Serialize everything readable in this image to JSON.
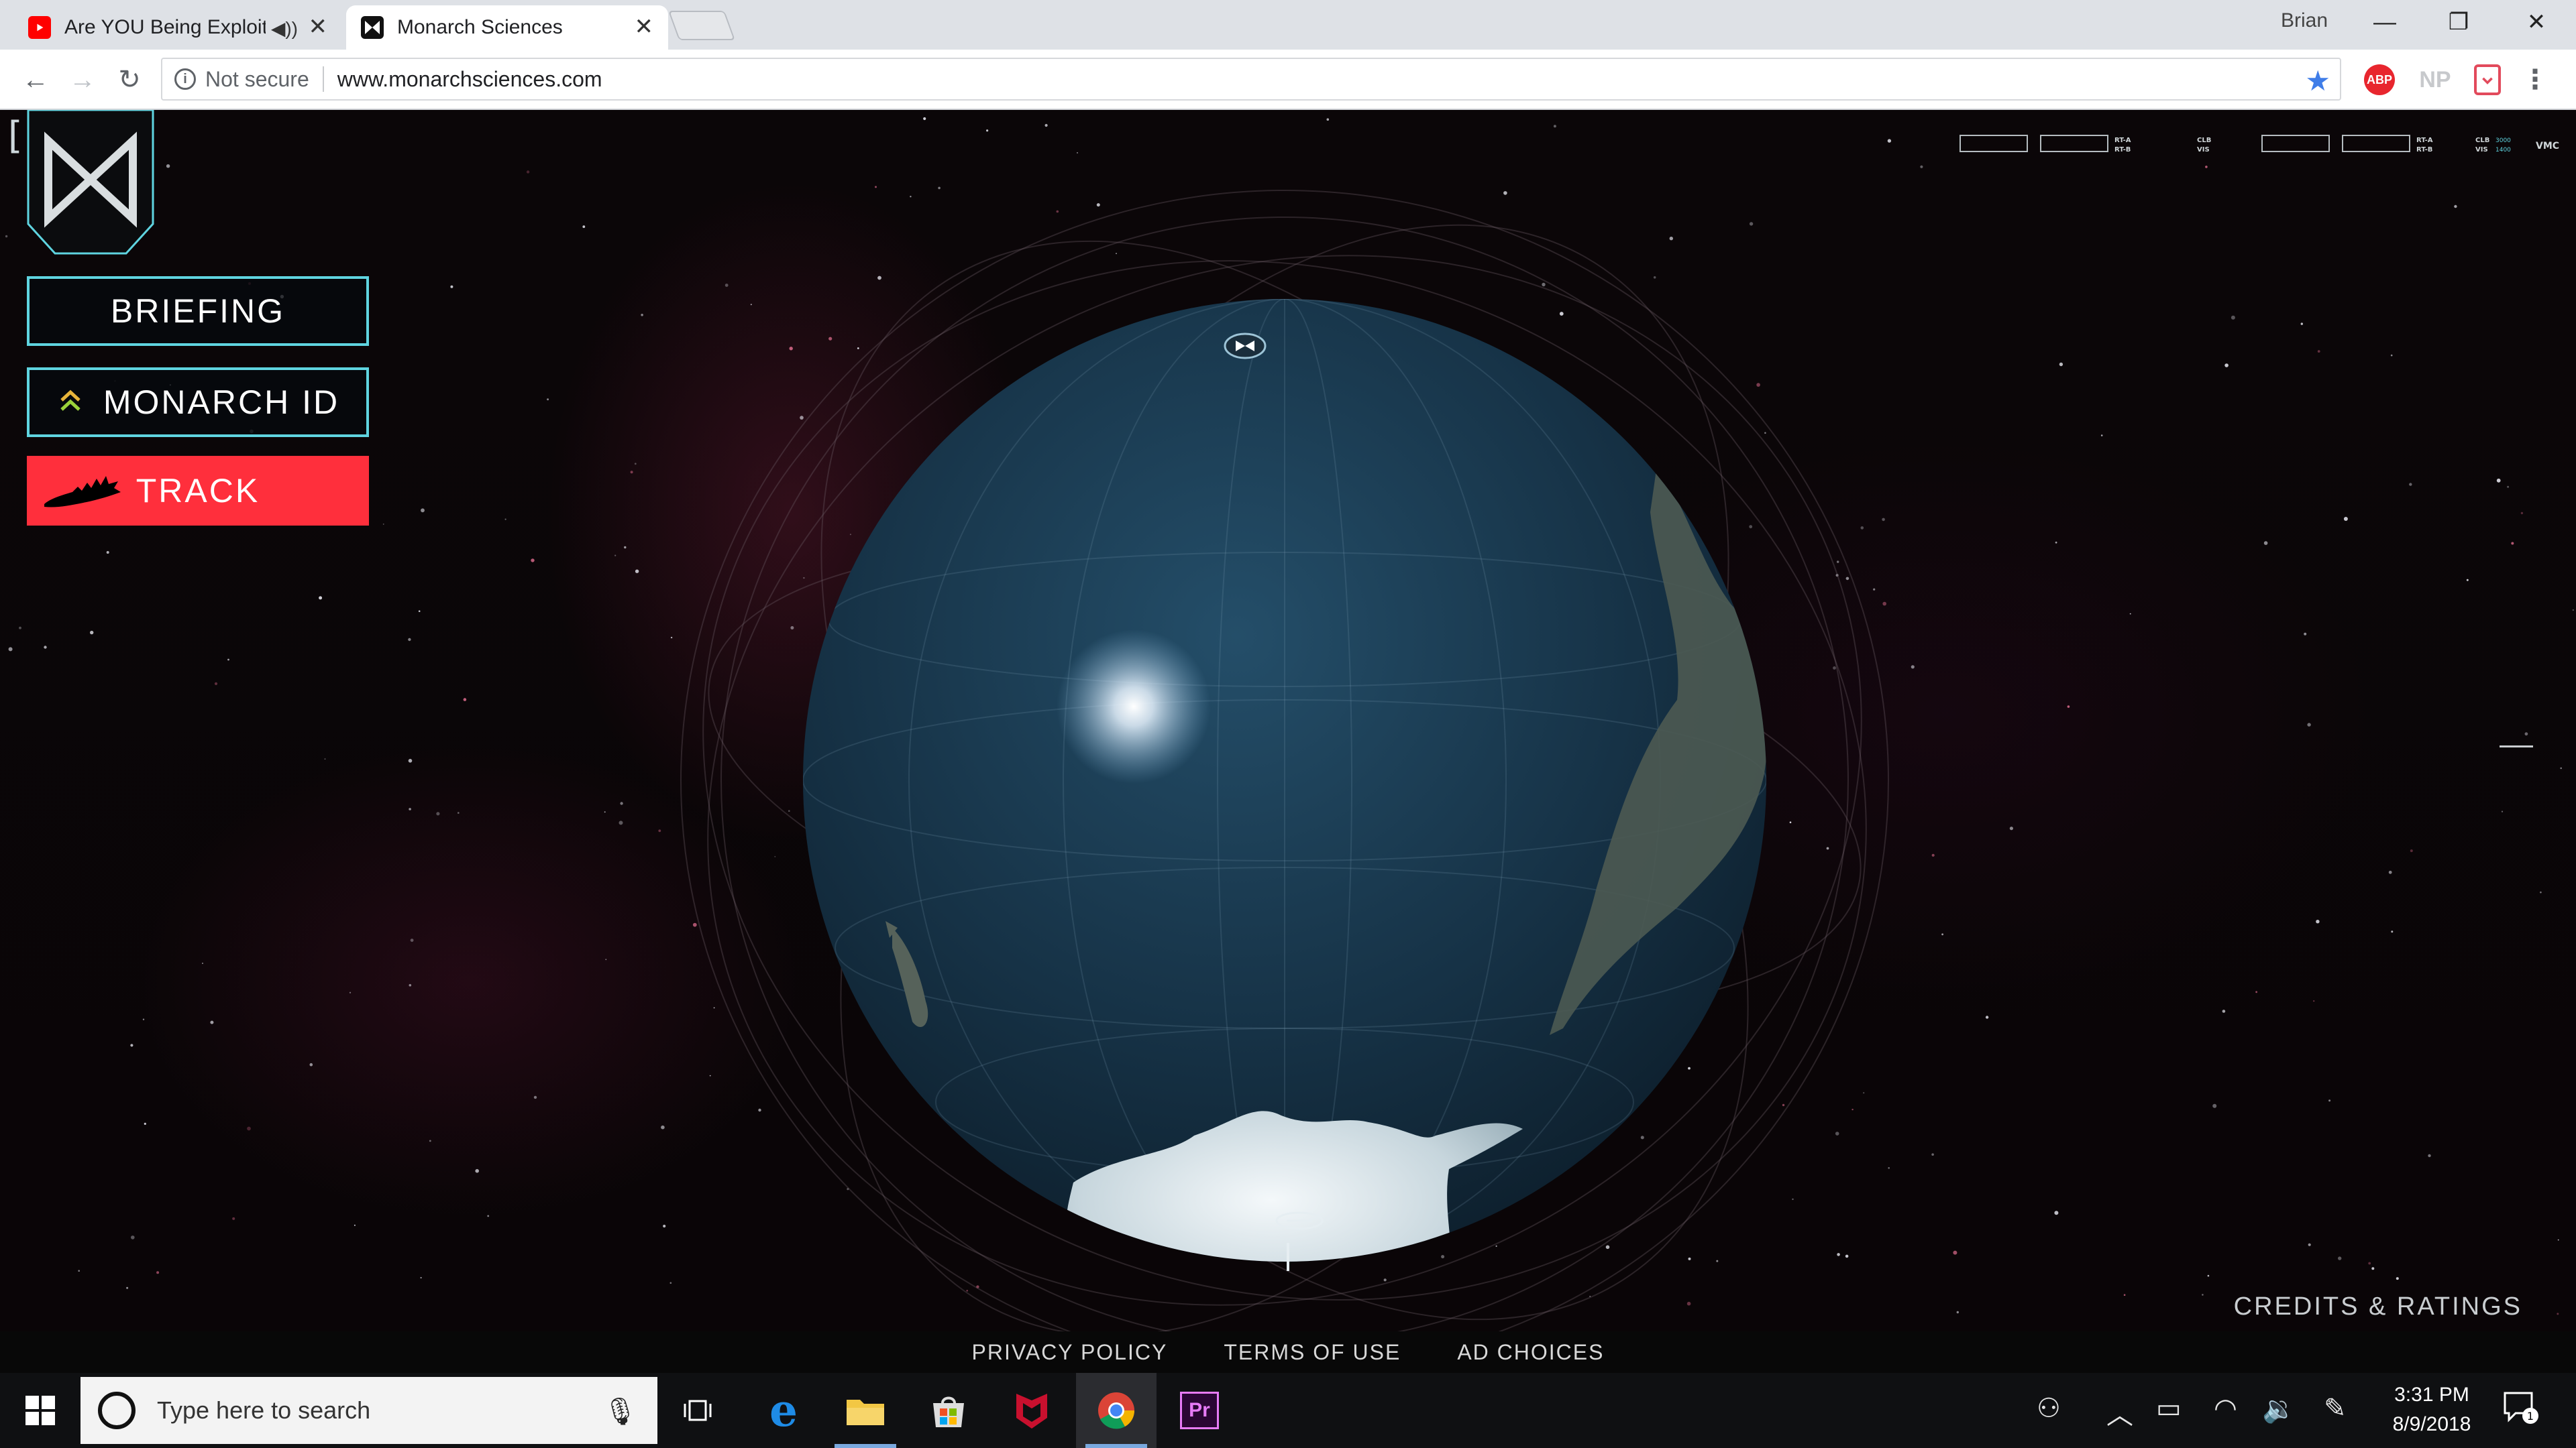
{
  "browser": {
    "tabs": [
      {
        "title": "Are YOU Being Exploit",
        "active": false,
        "favicon": "youtube-icon",
        "audio": true
      },
      {
        "title": "Monarch Sciences",
        "active": true,
        "favicon": "monarch-icon",
        "audio": false
      }
    ],
    "profile_name": "Brian",
    "security_label": "Not secure",
    "url": "www.monarchsciences.com",
    "extensions": {
      "abp": "ABP",
      "np": "NP"
    }
  },
  "site": {
    "menu": {
      "briefing": "BRIEFING",
      "monarch_id": "MONARCH ID",
      "track": "TRACK"
    },
    "credits": "CREDITS & RATINGS",
    "footer": {
      "privacy": "PRIVACY POLICY",
      "terms": "TERMS OF USE",
      "ad_choices": "AD CHOICES"
    },
    "hud": {
      "rt_a": "RT-A",
      "rt_b": "RT-B",
      "clb": "CLB",
      "vis": "VIS",
      "clb_value": "3000",
      "vis_value": "1400",
      "mode": "VMC"
    },
    "accent_color": "#5fd4e0",
    "track_color": "#ff2f3c"
  },
  "taskbar": {
    "search_placeholder": "Type here to search",
    "time": "3:31 PM",
    "date": "8/9/2018",
    "notifications": "1"
  }
}
